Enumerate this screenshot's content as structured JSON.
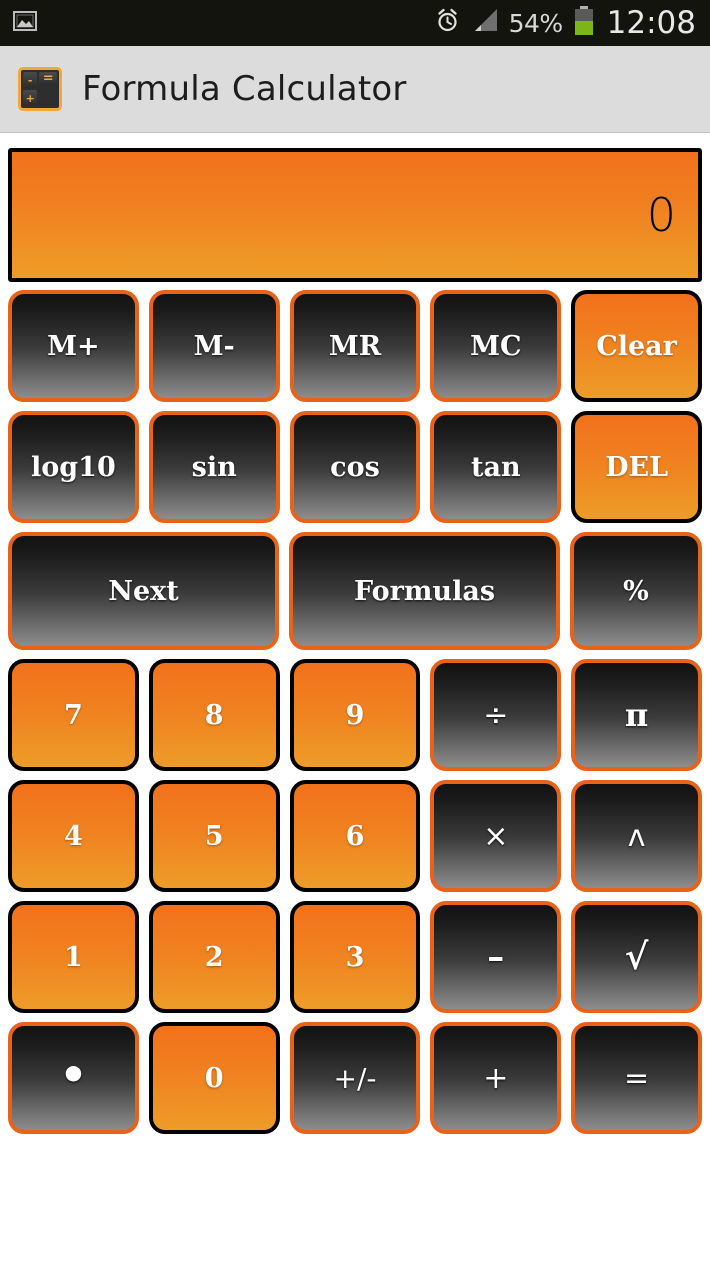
{
  "status_bar": {
    "notification_icon": "image-icon",
    "alarm_icon": "alarm-clock-icon",
    "signal_icon": "signal-bars-icon",
    "battery_percent": "54%",
    "battery_icon": "battery-icon",
    "time": "12:08",
    "background_color": "#14140f",
    "text_color": "#d8d8d8",
    "battery_fill_color": "#7cb518"
  },
  "title_bar": {
    "app_icon": "calculator-icon",
    "icon_keys": {
      "minus": "-",
      "plus": "+",
      "equals": "="
    },
    "title": "Formula Calculator",
    "background_color": "#dcdcdc",
    "text_color": "#1d1d1d"
  },
  "display": {
    "value": "0",
    "gradient_top": "#f2711c",
    "gradient_bottom": "#ee9d28",
    "border_color": "#000000",
    "text_color": "#000000"
  },
  "theme": {
    "accent_orange": "#e8621a",
    "key_orange_top": "#f2711c",
    "key_orange_bottom": "#ed9c29",
    "key_dark_top": "#121212",
    "key_dark_bottom": "#8d8d8d",
    "key_label_color": "#ffffff"
  },
  "keypad": {
    "rows": [
      {
        "name": "memory-row",
        "keys": [
          {
            "label": "M+",
            "style": "dark",
            "name": "memory-add-button"
          },
          {
            "label": "M-",
            "style": "dark",
            "name": "memory-subtract-button"
          },
          {
            "label": "MR",
            "style": "dark",
            "name": "memory-recall-button"
          },
          {
            "label": "MC",
            "style": "dark",
            "name": "memory-clear-button"
          },
          {
            "label": "Clear",
            "style": "orange",
            "name": "clear-button"
          }
        ]
      },
      {
        "name": "function-row",
        "keys": [
          {
            "label": "log10",
            "style": "dark",
            "name": "log10-button"
          },
          {
            "label": "sin",
            "style": "dark",
            "name": "sin-button"
          },
          {
            "label": "cos",
            "style": "dark",
            "name": "cos-button"
          },
          {
            "label": "tan",
            "style": "dark",
            "name": "tan-button"
          },
          {
            "label": "DEL",
            "style": "orange",
            "name": "delete-button"
          }
        ]
      },
      {
        "name": "navigation-row",
        "keys": [
          {
            "label": "Next",
            "style": "dark",
            "name": "next-button",
            "span": 2
          },
          {
            "label": "Formulas",
            "style": "dark",
            "name": "formulas-button",
            "span": 2
          },
          {
            "label": "%",
            "style": "dark",
            "name": "percent-button"
          }
        ]
      },
      {
        "name": "digit-row-789",
        "keys": [
          {
            "label": "7",
            "style": "orange",
            "name": "digit-7-button"
          },
          {
            "label": "8",
            "style": "orange",
            "name": "digit-8-button"
          },
          {
            "label": "9",
            "style": "orange",
            "name": "digit-9-button"
          },
          {
            "label": "÷",
            "style": "dark",
            "name": "divide-button"
          },
          {
            "label": "π",
            "style": "dark",
            "name": "pi-button"
          }
        ]
      },
      {
        "name": "digit-row-456",
        "keys": [
          {
            "label": "4",
            "style": "orange",
            "name": "digit-4-button"
          },
          {
            "label": "5",
            "style": "orange",
            "name": "digit-5-button"
          },
          {
            "label": "6",
            "style": "orange",
            "name": "digit-6-button"
          },
          {
            "label": "×",
            "style": "dark",
            "name": "multiply-button"
          },
          {
            "label": "ʌ",
            "style": "dark",
            "name": "power-button"
          }
        ]
      },
      {
        "name": "digit-row-123",
        "keys": [
          {
            "label": "1",
            "style": "orange",
            "name": "digit-1-button"
          },
          {
            "label": "2",
            "style": "orange",
            "name": "digit-2-button"
          },
          {
            "label": "3",
            "style": "orange",
            "name": "digit-3-button"
          },
          {
            "label": "–",
            "style": "dark",
            "name": "subtract-button"
          },
          {
            "label": "√",
            "style": "dark",
            "name": "square-root-button"
          }
        ]
      },
      {
        "name": "bottom-row",
        "keys": [
          {
            "label": "•",
            "style": "dark",
            "name": "decimal-point-button"
          },
          {
            "label": "0",
            "style": "orange",
            "name": "digit-0-button"
          },
          {
            "label": "+/-",
            "style": "dark",
            "name": "sign-toggle-button"
          },
          {
            "label": "+",
            "style": "dark",
            "name": "add-button"
          },
          {
            "label": "=",
            "style": "dark",
            "name": "equals-button"
          }
        ]
      }
    ]
  }
}
